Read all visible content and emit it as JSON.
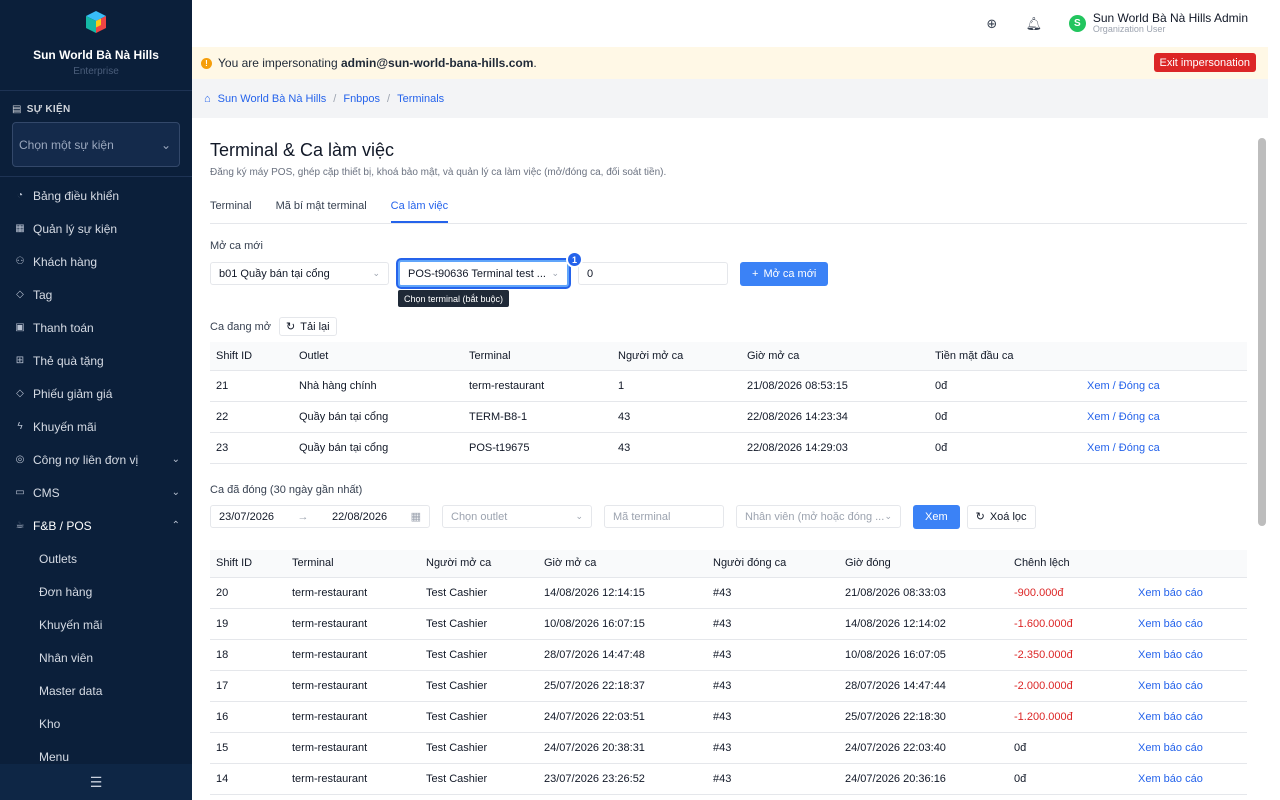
{
  "sidebar": {
    "brand_name": "Sun World Bà Nà Hills",
    "brand_sub": "Enterprise",
    "section_title": "SỰ KIỆN",
    "event_placeholder": "Chọn một sự kiện",
    "items": [
      {
        "label": "Bảng điều khiển",
        "icon": "dashboard-icon"
      },
      {
        "label": "Quản lý sự kiện",
        "icon": "calendar-icon"
      },
      {
        "label": "Khách hàng",
        "icon": "users-icon"
      },
      {
        "label": "Tag",
        "icon": "tag-icon"
      },
      {
        "label": "Thanh toán",
        "icon": "payment-icon"
      },
      {
        "label": "Thẻ quà tặng",
        "icon": "gift-icon"
      },
      {
        "label": "Phiếu giảm giá",
        "icon": "coupon-icon"
      },
      {
        "label": "Khuyến mãi",
        "icon": "promotion-icon"
      },
      {
        "label": "Công nợ liên đơn vị",
        "icon": "debt-icon"
      },
      {
        "label": "CMS",
        "icon": "cms-icon"
      },
      {
        "label": "F&B / POS",
        "icon": "pos-icon"
      }
    ],
    "sub_items": [
      "Outlets",
      "Đơn hàng",
      "Khuyến mãi",
      "Nhân viên",
      "Master data",
      "Kho",
      "Menu"
    ]
  },
  "topbar": {
    "user_name": "Sun World Bà Nà Hills Admin",
    "user_role": "Organization User",
    "avatar_letter": "S"
  },
  "banner": {
    "prefix": "You are impersonating",
    "email": "admin@sun-world-bana-hills.com",
    "suffix": ".",
    "exit_label": "Exit impersonation"
  },
  "breadcrumb": [
    "Sun World Bà Nà Hills",
    "Fnbpos",
    "Terminals"
  ],
  "page": {
    "title": "Terminal & Ca làm việc",
    "description": "Đăng ký máy POS, ghép cặp thiết bị, khoá bảo mật, và quản lý ca làm việc (mở/đóng ca, đối soát tiền).",
    "tabs": [
      "Terminal",
      "Mã bí mật terminal",
      "Ca làm việc"
    ]
  },
  "open_shift": {
    "label": "Mở ca mới",
    "outlet_value": "b01 Quầy bán tại cổng",
    "terminal_value": "POS-t90636 Terminal test ...",
    "badge": "1",
    "tooltip": "Chọn terminal (bắt buộc)",
    "cash_value": "0",
    "button_label": "Mở ca mới"
  },
  "open_shifts": {
    "label": "Ca đang mở",
    "reload_label": "Tải lại",
    "columns": [
      "Shift ID",
      "Outlet",
      "Terminal",
      "Người mở ca",
      "Giờ mở ca",
      "Tiền mặt đầu ca",
      ""
    ],
    "rows": [
      [
        "21",
        "Nhà hàng chính",
        "term-restaurant",
        "1",
        "21/08/2026 08:53:15",
        "0đ",
        "Xem / Đóng ca"
      ],
      [
        "22",
        "Quầy bán tại cổng",
        "TERM-B8-1",
        "43",
        "22/08/2026 14:23:34",
        "0đ",
        "Xem / Đóng ca"
      ],
      [
        "23",
        "Quầy bán tại cổng",
        "POS-t19675",
        "43",
        "22/08/2026 14:29:03",
        "0đ",
        "Xem / Đóng ca"
      ]
    ]
  },
  "closed_shifts": {
    "label": "Ca đã đóng (30 ngày gần nhất)",
    "date_from": "23/07/2026",
    "date_to": "22/08/2026",
    "outlet_placeholder": "Chọn outlet",
    "terminal_placeholder": "Mã terminal",
    "staff_placeholder": "Nhân viên (mở hoặc đóng ...",
    "view_label": "Xem",
    "clear_label": "Xoá lọc",
    "columns": [
      "Shift ID",
      "Terminal",
      "Người mở ca",
      "Giờ mở ca",
      "Người đóng ca",
      "Giờ đóng",
      "Chênh lệch",
      ""
    ],
    "rows": [
      [
        "20",
        "term-restaurant",
        "Test Cashier",
        "14/08/2026 12:14:15",
        "#43",
        "21/08/2026 08:33:03",
        "-900.000đ",
        "Xem báo cáo"
      ],
      [
        "19",
        "term-restaurant",
        "Test Cashier",
        "10/08/2026 16:07:15",
        "#43",
        "14/08/2026 12:14:02",
        "-1.600.000đ",
        "Xem báo cáo"
      ],
      [
        "18",
        "term-restaurant",
        "Test Cashier",
        "28/07/2026 14:47:48",
        "#43",
        "10/08/2026 16:07:05",
        "-2.350.000đ",
        "Xem báo cáo"
      ],
      [
        "17",
        "term-restaurant",
        "Test Cashier",
        "25/07/2026 22:18:37",
        "#43",
        "28/07/2026 14:47:44",
        "-2.000.000đ",
        "Xem báo cáo"
      ],
      [
        "16",
        "term-restaurant",
        "Test Cashier",
        "24/07/2026 22:03:51",
        "#43",
        "25/07/2026 22:18:30",
        "-1.200.000đ",
        "Xem báo cáo"
      ],
      [
        "15",
        "term-restaurant",
        "Test Cashier",
        "24/07/2026 20:38:31",
        "#43",
        "24/07/2026 22:03:40",
        "0đ",
        "Xem báo cáo"
      ],
      [
        "14",
        "term-restaurant",
        "Test Cashier",
        "23/07/2026 23:26:52",
        "#43",
        "24/07/2026 20:36:16",
        "0đ",
        "Xem báo cáo"
      ]
    ]
  },
  "colors": {
    "sidebar_bg": "#0b1f3a",
    "accent": "#2563eb",
    "danger": "#dc2626"
  }
}
